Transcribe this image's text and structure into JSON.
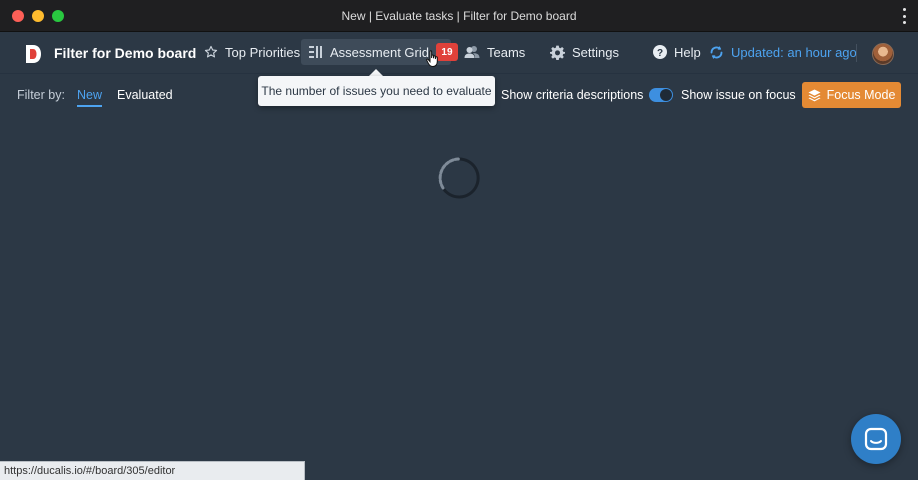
{
  "window": {
    "title": "New | Evaluate tasks | Filter for Demo board"
  },
  "nav": {
    "board_title": "Filter for Demo board",
    "top_priorities": "Top Priorities",
    "assessment_grid": "Assessment Grid",
    "assessment_badge": "19",
    "teams": "Teams",
    "settings": "Settings",
    "help": "Help",
    "updated": "Updated: an hour ago"
  },
  "filter": {
    "label": "Filter by:",
    "new": "New",
    "evaluated": "Evaluated",
    "show_criteria": "Show criteria descriptions",
    "show_issue": "Show issue on focus",
    "show_issue_on": true,
    "focus_mode": "Focus Mode"
  },
  "tooltip": {
    "text": "The number of issues you need to evaluate"
  },
  "status_bar": {
    "url": "https://ducalis.io/#/board/305/editor"
  },
  "colors": {
    "background": "#2c3845",
    "accent_blue": "#4da3f0",
    "badge_red": "#e0413a",
    "focus_orange": "#e48a34",
    "chat_blue": "#2f7fc7"
  },
  "icons": [
    "logo-icon",
    "star-icon",
    "grid-icon",
    "teams-icon",
    "gear-icon",
    "help-icon",
    "refresh-icon",
    "layers-icon",
    "chat-icon",
    "kebab-icon",
    "hand-cursor-icon",
    "loading-spinner-icon"
  ]
}
